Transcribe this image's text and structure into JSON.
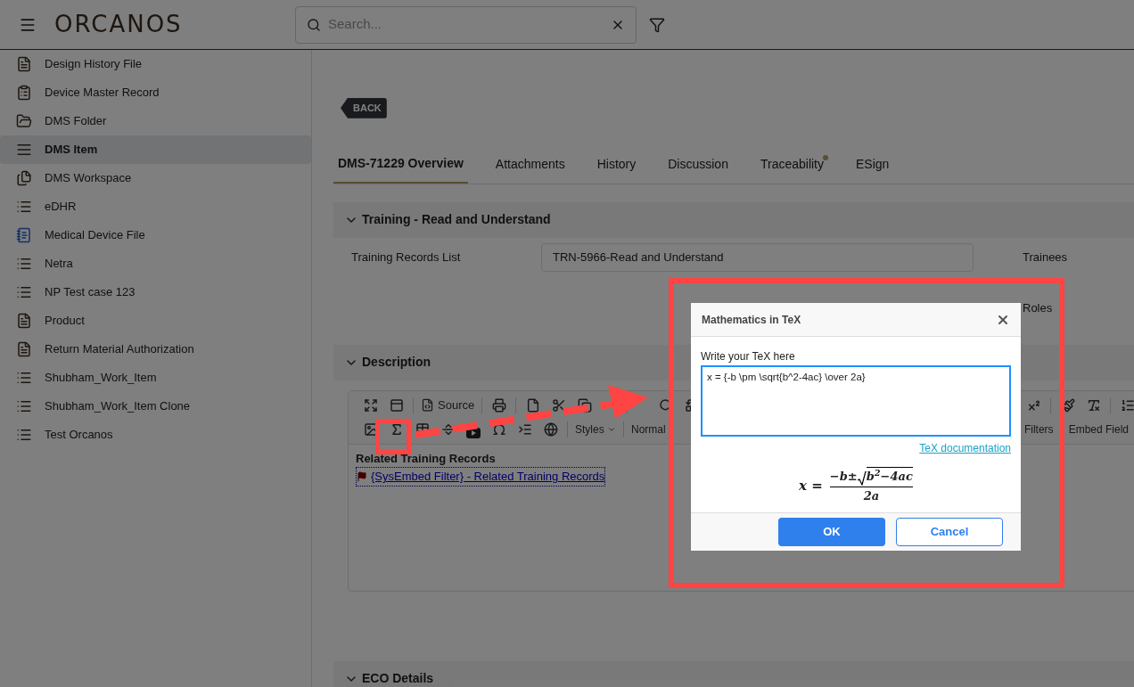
{
  "header": {
    "logo": "ORCANOS",
    "search": {
      "placeholder": "Search..."
    }
  },
  "sidebar": {
    "items": [
      {
        "label": "Design History File",
        "kind": "file",
        "selected": false
      },
      {
        "label": "Device Master Record",
        "kind": "clipboard",
        "selected": false
      },
      {
        "label": "DMS Folder",
        "kind": "folder",
        "selected": false
      },
      {
        "label": "DMS Item",
        "kind": "lines",
        "selected": true
      },
      {
        "label": "DMS Workspace",
        "kind": "pages",
        "selected": false
      },
      {
        "label": "eDHR",
        "kind": "list",
        "selected": false
      },
      {
        "label": "Medical Device File",
        "kind": "notes",
        "selected": false
      },
      {
        "label": "Netra",
        "kind": "list",
        "selected": false
      },
      {
        "label": "NP Test case 123",
        "kind": "list",
        "selected": false
      },
      {
        "label": "Product",
        "kind": "file",
        "selected": false
      },
      {
        "label": "Return Material Authorization",
        "kind": "file",
        "selected": false
      },
      {
        "label": "Shubham_Work_Item",
        "kind": "list",
        "selected": false
      },
      {
        "label": "Shubham_Work_Item Clone",
        "kind": "list",
        "selected": false
      },
      {
        "label": "Test Orcanos",
        "kind": "list",
        "selected": false
      }
    ]
  },
  "back_button": "BACK",
  "tabs": [
    {
      "label": "DMS-71229 Overview",
      "selected": true,
      "dot": false
    },
    {
      "label": "Attachments",
      "selected": false,
      "dot": false
    },
    {
      "label": "History",
      "selected": false,
      "dot": false
    },
    {
      "label": "Discussion",
      "selected": false,
      "dot": false
    },
    {
      "label": "Traceability",
      "selected": false,
      "dot": true
    },
    {
      "label": "ESign",
      "selected": false,
      "dot": false
    }
  ],
  "training": {
    "title": "Training - Read and Understand",
    "field_label": "Training Records List",
    "field_value": "TRN-5966-Read and Understand",
    "side_labels": [
      "Trainees",
      "Roles"
    ]
  },
  "description": {
    "title": "Description",
    "toolbar": {
      "source": "Source",
      "styles": "Styles",
      "format": "Normal",
      "filters": "Filters",
      "embed_field": "Embed Field"
    },
    "content": {
      "heading": "Related Training Records",
      "link": "{SysEmbed Filter} - Related Training Records"
    }
  },
  "eco": {
    "title": "ECO Details"
  },
  "dialog": {
    "title": "Mathematics in TeX",
    "label": "Write your TeX here",
    "value": "x = {-b \\pm \\sqrt{b^2-4ac} \\over 2a}",
    "link": "TeX documentation",
    "formula": {
      "lhs": "x =",
      "prefix": "−b±",
      "radicand": "b$^{2}$−4ac",
      "denominator": "2a"
    },
    "ok": "OK",
    "cancel": "Cancel"
  }
}
